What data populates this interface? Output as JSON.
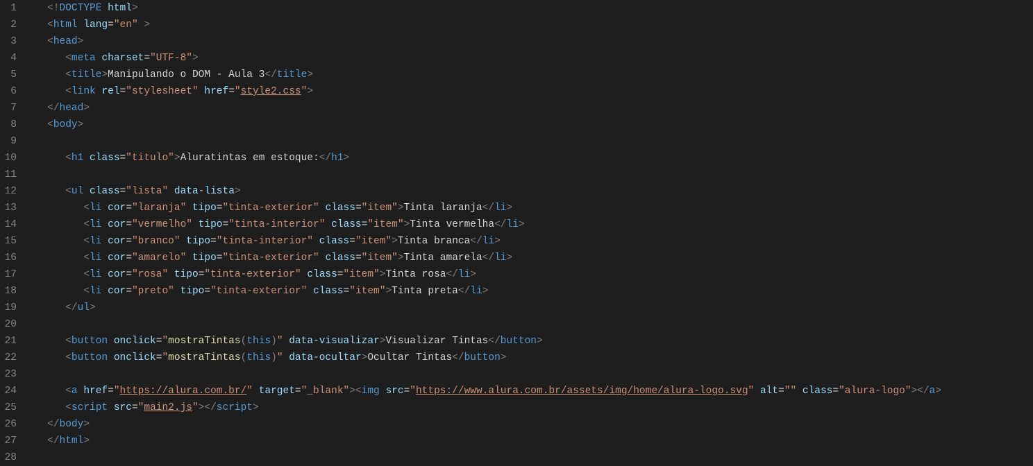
{
  "lines": [
    {
      "n": "1",
      "ind": 1,
      "seg": [
        {
          "c": "br",
          "t": "<!"
        },
        {
          "c": "t",
          "t": "DOCTYPE"
        },
        {
          "c": "tx",
          "t": " "
        },
        {
          "c": "at",
          "t": "html"
        },
        {
          "c": "br",
          "t": ">"
        }
      ]
    },
    {
      "n": "2",
      "ind": 1,
      "seg": [
        {
          "c": "br",
          "t": "<"
        },
        {
          "c": "t",
          "t": "html"
        },
        {
          "c": "tx",
          "t": " "
        },
        {
          "c": "at",
          "t": "lang"
        },
        {
          "c": "eq",
          "t": "="
        },
        {
          "c": "st",
          "t": "\"en\""
        },
        {
          "c": "tx",
          "t": " "
        },
        {
          "c": "br",
          "t": ">"
        }
      ]
    },
    {
      "n": "3",
      "ind": 1,
      "seg": [
        {
          "c": "br",
          "t": "<"
        },
        {
          "c": "t",
          "t": "head"
        },
        {
          "c": "br",
          "t": ">"
        }
      ]
    },
    {
      "n": "4",
      "ind": 2,
      "seg": [
        {
          "c": "br",
          "t": "<"
        },
        {
          "c": "t",
          "t": "meta"
        },
        {
          "c": "tx",
          "t": " "
        },
        {
          "c": "at",
          "t": "charset"
        },
        {
          "c": "eq",
          "t": "="
        },
        {
          "c": "st",
          "t": "\"UTF-8\""
        },
        {
          "c": "br",
          "t": ">"
        }
      ]
    },
    {
      "n": "5",
      "ind": 2,
      "seg": [
        {
          "c": "br",
          "t": "<"
        },
        {
          "c": "t",
          "t": "title"
        },
        {
          "c": "br",
          "t": ">"
        },
        {
          "c": "tx",
          "t": "Manipulando o DOM - Aula 3"
        },
        {
          "c": "br",
          "t": "</"
        },
        {
          "c": "t",
          "t": "title"
        },
        {
          "c": "br",
          "t": ">"
        }
      ]
    },
    {
      "n": "6",
      "ind": 2,
      "seg": [
        {
          "c": "br",
          "t": "<"
        },
        {
          "c": "t",
          "t": "link"
        },
        {
          "c": "tx",
          "t": " "
        },
        {
          "c": "at",
          "t": "rel"
        },
        {
          "c": "eq",
          "t": "="
        },
        {
          "c": "st",
          "t": "\"stylesheet\""
        },
        {
          "c": "tx",
          "t": " "
        },
        {
          "c": "at",
          "t": "href"
        },
        {
          "c": "eq",
          "t": "="
        },
        {
          "c": "st",
          "t": "\""
        },
        {
          "c": "st un",
          "t": "style2.css"
        },
        {
          "c": "st",
          "t": "\""
        },
        {
          "c": "br",
          "t": ">"
        }
      ]
    },
    {
      "n": "7",
      "ind": 1,
      "seg": [
        {
          "c": "br",
          "t": "</"
        },
        {
          "c": "t",
          "t": "head"
        },
        {
          "c": "br",
          "t": ">"
        }
      ]
    },
    {
      "n": "8",
      "ind": 1,
      "seg": [
        {
          "c": "br",
          "t": "<"
        },
        {
          "c": "t",
          "t": "body"
        },
        {
          "c": "br",
          "t": ">"
        }
      ]
    },
    {
      "n": "9",
      "ind": 0,
      "seg": []
    },
    {
      "n": "10",
      "ind": 2,
      "seg": [
        {
          "c": "br",
          "t": "<"
        },
        {
          "c": "t",
          "t": "h1"
        },
        {
          "c": "tx",
          "t": " "
        },
        {
          "c": "at",
          "t": "class"
        },
        {
          "c": "eq",
          "t": "="
        },
        {
          "c": "st",
          "t": "\"titulo\""
        },
        {
          "c": "br",
          "t": ">"
        },
        {
          "c": "tx",
          "t": "Aluratintas em estoque:"
        },
        {
          "c": "br",
          "t": "</"
        },
        {
          "c": "t",
          "t": "h1"
        },
        {
          "c": "br",
          "t": ">"
        }
      ]
    },
    {
      "n": "11",
      "ind": 0,
      "seg": []
    },
    {
      "n": "12",
      "ind": 2,
      "seg": [
        {
          "c": "br",
          "t": "<"
        },
        {
          "c": "t",
          "t": "ul"
        },
        {
          "c": "tx",
          "t": " "
        },
        {
          "c": "at",
          "t": "class"
        },
        {
          "c": "eq",
          "t": "="
        },
        {
          "c": "st",
          "t": "\"lista\""
        },
        {
          "c": "tx",
          "t": " "
        },
        {
          "c": "at",
          "t": "data-lista"
        },
        {
          "c": "br",
          "t": ">"
        }
      ]
    },
    {
      "n": "13",
      "ind": 3,
      "seg": [
        {
          "c": "br",
          "t": "<"
        },
        {
          "c": "t",
          "t": "li"
        },
        {
          "c": "tx",
          "t": " "
        },
        {
          "c": "at",
          "t": "cor"
        },
        {
          "c": "eq",
          "t": "="
        },
        {
          "c": "st",
          "t": "\"laranja\""
        },
        {
          "c": "tx",
          "t": " "
        },
        {
          "c": "at",
          "t": "tipo"
        },
        {
          "c": "eq",
          "t": "="
        },
        {
          "c": "st",
          "t": "\"tinta-exterior\""
        },
        {
          "c": "tx",
          "t": " "
        },
        {
          "c": "at",
          "t": "class"
        },
        {
          "c": "eq",
          "t": "="
        },
        {
          "c": "st",
          "t": "\"item\""
        },
        {
          "c": "br",
          "t": ">"
        },
        {
          "c": "tx",
          "t": "Tinta laranja"
        },
        {
          "c": "br",
          "t": "</"
        },
        {
          "c": "t",
          "t": "li"
        },
        {
          "c": "br",
          "t": ">"
        }
      ]
    },
    {
      "n": "14",
      "ind": 3,
      "seg": [
        {
          "c": "br",
          "t": "<"
        },
        {
          "c": "t",
          "t": "li"
        },
        {
          "c": "tx",
          "t": " "
        },
        {
          "c": "at",
          "t": "cor"
        },
        {
          "c": "eq",
          "t": "="
        },
        {
          "c": "st",
          "t": "\"vermelho\""
        },
        {
          "c": "tx",
          "t": " "
        },
        {
          "c": "at",
          "t": "tipo"
        },
        {
          "c": "eq",
          "t": "="
        },
        {
          "c": "st",
          "t": "\"tinta-interior\""
        },
        {
          "c": "tx",
          "t": " "
        },
        {
          "c": "at",
          "t": "class"
        },
        {
          "c": "eq",
          "t": "="
        },
        {
          "c": "st",
          "t": "\"item\""
        },
        {
          "c": "br",
          "t": ">"
        },
        {
          "c": "tx",
          "t": "Tinta vermelha"
        },
        {
          "c": "br",
          "t": "</"
        },
        {
          "c": "t",
          "t": "li"
        },
        {
          "c": "br",
          "t": ">"
        }
      ]
    },
    {
      "n": "15",
      "ind": 3,
      "seg": [
        {
          "c": "br",
          "t": "<"
        },
        {
          "c": "t",
          "t": "li"
        },
        {
          "c": "tx",
          "t": " "
        },
        {
          "c": "at",
          "t": "cor"
        },
        {
          "c": "eq",
          "t": "="
        },
        {
          "c": "st",
          "t": "\"branco\""
        },
        {
          "c": "tx",
          "t": " "
        },
        {
          "c": "at",
          "t": "tipo"
        },
        {
          "c": "eq",
          "t": "="
        },
        {
          "c": "st",
          "t": "\"tinta-interior\""
        },
        {
          "c": "tx",
          "t": " "
        },
        {
          "c": "at",
          "t": "class"
        },
        {
          "c": "eq",
          "t": "="
        },
        {
          "c": "st",
          "t": "\"item\""
        },
        {
          "c": "br",
          "t": ">"
        },
        {
          "c": "tx",
          "t": "Tinta branca"
        },
        {
          "c": "br",
          "t": "</"
        },
        {
          "c": "t",
          "t": "li"
        },
        {
          "c": "br",
          "t": ">"
        }
      ]
    },
    {
      "n": "16",
      "ind": 3,
      "seg": [
        {
          "c": "br",
          "t": "<"
        },
        {
          "c": "t",
          "t": "li"
        },
        {
          "c": "tx",
          "t": " "
        },
        {
          "c": "at",
          "t": "cor"
        },
        {
          "c": "eq",
          "t": "="
        },
        {
          "c": "st",
          "t": "\"amarelo\""
        },
        {
          "c": "tx",
          "t": " "
        },
        {
          "c": "at",
          "t": "tipo"
        },
        {
          "c": "eq",
          "t": "="
        },
        {
          "c": "st",
          "t": "\"tinta-exterior\""
        },
        {
          "c": "tx",
          "t": " "
        },
        {
          "c": "at",
          "t": "class"
        },
        {
          "c": "eq",
          "t": "="
        },
        {
          "c": "st",
          "t": "\"item\""
        },
        {
          "c": "br",
          "t": ">"
        },
        {
          "c": "tx",
          "t": "Tinta amarela"
        },
        {
          "c": "br",
          "t": "</"
        },
        {
          "c": "t",
          "t": "li"
        },
        {
          "c": "br",
          "t": ">"
        }
      ]
    },
    {
      "n": "17",
      "ind": 3,
      "seg": [
        {
          "c": "br",
          "t": "<"
        },
        {
          "c": "t",
          "t": "li"
        },
        {
          "c": "tx",
          "t": " "
        },
        {
          "c": "at",
          "t": "cor"
        },
        {
          "c": "eq",
          "t": "="
        },
        {
          "c": "st",
          "t": "\"rosa\""
        },
        {
          "c": "tx",
          "t": " "
        },
        {
          "c": "at",
          "t": "tipo"
        },
        {
          "c": "eq",
          "t": "="
        },
        {
          "c": "st",
          "t": "\"tinta-exterior\""
        },
        {
          "c": "tx",
          "t": " "
        },
        {
          "c": "at",
          "t": "class"
        },
        {
          "c": "eq",
          "t": "="
        },
        {
          "c": "st",
          "t": "\"item\""
        },
        {
          "c": "br",
          "t": ">"
        },
        {
          "c": "tx",
          "t": "Tinta rosa"
        },
        {
          "c": "br",
          "t": "</"
        },
        {
          "c": "t",
          "t": "li"
        },
        {
          "c": "br",
          "t": ">"
        }
      ]
    },
    {
      "n": "18",
      "ind": 3,
      "seg": [
        {
          "c": "br",
          "t": "<"
        },
        {
          "c": "t",
          "t": "li"
        },
        {
          "c": "tx",
          "t": " "
        },
        {
          "c": "at",
          "t": "cor"
        },
        {
          "c": "eq",
          "t": "="
        },
        {
          "c": "st",
          "t": "\"preto\""
        },
        {
          "c": "tx",
          "t": " "
        },
        {
          "c": "at",
          "t": "tipo"
        },
        {
          "c": "eq",
          "t": "="
        },
        {
          "c": "st",
          "t": "\"tinta-exterior\""
        },
        {
          "c": "tx",
          "t": " "
        },
        {
          "c": "at",
          "t": "class"
        },
        {
          "c": "eq",
          "t": "="
        },
        {
          "c": "st",
          "t": "\"item\""
        },
        {
          "c": "br",
          "t": ">"
        },
        {
          "c": "tx",
          "t": "Tinta preta"
        },
        {
          "c": "br",
          "t": "</"
        },
        {
          "c": "t",
          "t": "li"
        },
        {
          "c": "br",
          "t": ">"
        }
      ]
    },
    {
      "n": "19",
      "ind": 2,
      "seg": [
        {
          "c": "br",
          "t": "</"
        },
        {
          "c": "t",
          "t": "ul"
        },
        {
          "c": "br",
          "t": ">"
        }
      ]
    },
    {
      "n": "20",
      "ind": 0,
      "seg": []
    },
    {
      "n": "21",
      "ind": 2,
      "seg": [
        {
          "c": "br",
          "t": "<"
        },
        {
          "c": "t",
          "t": "button"
        },
        {
          "c": "tx",
          "t": " "
        },
        {
          "c": "at",
          "t": "onclick"
        },
        {
          "c": "eq",
          "t": "="
        },
        {
          "c": "st",
          "t": "\""
        },
        {
          "c": "fn",
          "t": "mostraTintas"
        },
        {
          "c": "br",
          "t": "("
        },
        {
          "c": "kw",
          "t": "this"
        },
        {
          "c": "br",
          "t": ")"
        },
        {
          "c": "st",
          "t": "\""
        },
        {
          "c": "tx",
          "t": " "
        },
        {
          "c": "at",
          "t": "data-visualizar"
        },
        {
          "c": "br",
          "t": ">"
        },
        {
          "c": "tx",
          "t": "Visualizar Tintas"
        },
        {
          "c": "br",
          "t": "</"
        },
        {
          "c": "t",
          "t": "button"
        },
        {
          "c": "br",
          "t": ">"
        }
      ]
    },
    {
      "n": "22",
      "ind": 2,
      "seg": [
        {
          "c": "br",
          "t": "<"
        },
        {
          "c": "t",
          "t": "button"
        },
        {
          "c": "tx",
          "t": " "
        },
        {
          "c": "at",
          "t": "onclick"
        },
        {
          "c": "eq",
          "t": "="
        },
        {
          "c": "st",
          "t": "\""
        },
        {
          "c": "fn",
          "t": "mostraTintas"
        },
        {
          "c": "br",
          "t": "("
        },
        {
          "c": "kw",
          "t": "this"
        },
        {
          "c": "br",
          "t": ")"
        },
        {
          "c": "st",
          "t": "\""
        },
        {
          "c": "tx",
          "t": " "
        },
        {
          "c": "at",
          "t": "data-ocultar"
        },
        {
          "c": "br",
          "t": ">"
        },
        {
          "c": "tx",
          "t": "Ocultar Tintas"
        },
        {
          "c": "br",
          "t": "</"
        },
        {
          "c": "t",
          "t": "button"
        },
        {
          "c": "br",
          "t": ">"
        }
      ]
    },
    {
      "n": "23",
      "ind": 0,
      "seg": []
    },
    {
      "n": "24",
      "ind": 2,
      "seg": [
        {
          "c": "br",
          "t": "<"
        },
        {
          "c": "t",
          "t": "a"
        },
        {
          "c": "tx",
          "t": " "
        },
        {
          "c": "at",
          "t": "href"
        },
        {
          "c": "eq",
          "t": "="
        },
        {
          "c": "st",
          "t": "\""
        },
        {
          "c": "st un",
          "t": "https://alura.com.br/"
        },
        {
          "c": "st",
          "t": "\""
        },
        {
          "c": "tx",
          "t": " "
        },
        {
          "c": "at",
          "t": "target"
        },
        {
          "c": "eq",
          "t": "="
        },
        {
          "c": "st",
          "t": "\"_blank\""
        },
        {
          "c": "br",
          "t": "><"
        },
        {
          "c": "t",
          "t": "img"
        },
        {
          "c": "tx",
          "t": " "
        },
        {
          "c": "at",
          "t": "src"
        },
        {
          "c": "eq",
          "t": "="
        },
        {
          "c": "st",
          "t": "\""
        },
        {
          "c": "st un",
          "t": "https://www.alura.com.br/assets/img/home/alura-logo.svg"
        },
        {
          "c": "st",
          "t": "\""
        },
        {
          "c": "tx",
          "t": " "
        },
        {
          "c": "at",
          "t": "alt"
        },
        {
          "c": "eq",
          "t": "="
        },
        {
          "c": "st",
          "t": "\"\""
        },
        {
          "c": "tx",
          "t": " "
        },
        {
          "c": "at",
          "t": "class"
        },
        {
          "c": "eq",
          "t": "="
        },
        {
          "c": "st",
          "t": "\"alura-logo\""
        },
        {
          "c": "br",
          "t": "></"
        },
        {
          "c": "t",
          "t": "a"
        },
        {
          "c": "br",
          "t": ">"
        }
      ]
    },
    {
      "n": "25",
      "ind": 2,
      "seg": [
        {
          "c": "br",
          "t": "<"
        },
        {
          "c": "t",
          "t": "script"
        },
        {
          "c": "tx",
          "t": " "
        },
        {
          "c": "at",
          "t": "src"
        },
        {
          "c": "eq",
          "t": "="
        },
        {
          "c": "st",
          "t": "\""
        },
        {
          "c": "st un",
          "t": "main2.js"
        },
        {
          "c": "st",
          "t": "\""
        },
        {
          "c": "br",
          "t": "></"
        },
        {
          "c": "t",
          "t": "script"
        },
        {
          "c": "br",
          "t": ">"
        }
      ]
    },
    {
      "n": "26",
      "ind": 1,
      "seg": [
        {
          "c": "br",
          "t": "</"
        },
        {
          "c": "t",
          "t": "body"
        },
        {
          "c": "br",
          "t": ">"
        }
      ]
    },
    {
      "n": "27",
      "ind": 1,
      "seg": [
        {
          "c": "br",
          "t": "</"
        },
        {
          "c": "t",
          "t": "html"
        },
        {
          "c": "br",
          "t": ">"
        }
      ]
    },
    {
      "n": "28",
      "ind": 0,
      "seg": []
    }
  ],
  "indentUnit": "   "
}
